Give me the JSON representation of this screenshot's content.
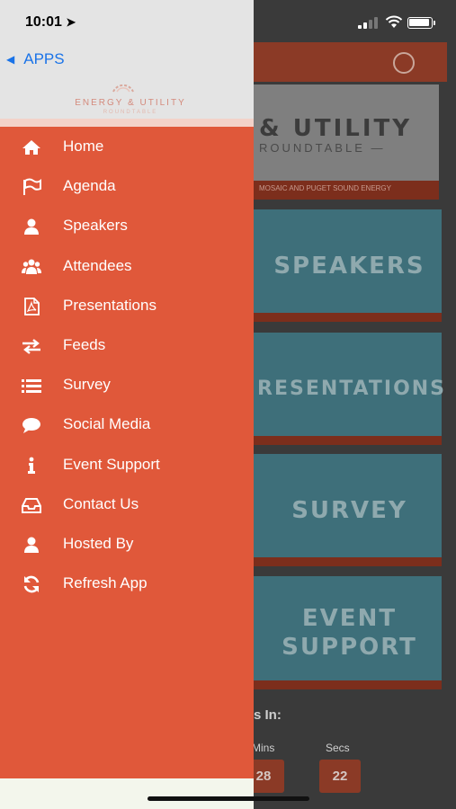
{
  "status_bar": {
    "time": "10:01"
  },
  "drawer": {
    "back_label": "APPS",
    "logo": {
      "line1": "ENERGY & UTILITY",
      "line2": "ROUNDTABLE"
    },
    "menu": [
      {
        "label": "Home",
        "icon": "home-icon"
      },
      {
        "label": "Agenda",
        "icon": "flag-icon"
      },
      {
        "label": "Speakers",
        "icon": "user-icon"
      },
      {
        "label": "Attendees",
        "icon": "users-icon"
      },
      {
        "label": "Presentations",
        "icon": "pdf-file-icon"
      },
      {
        "label": "Feeds",
        "icon": "exchange-icon"
      },
      {
        "label": "Survey",
        "icon": "list-icon"
      },
      {
        "label": "Social Media",
        "icon": "comment-icon"
      },
      {
        "label": "Event Support",
        "icon": "info-icon"
      },
      {
        "label": "Contact Us",
        "icon": "inbox-icon"
      },
      {
        "label": "Hosted By",
        "icon": "user-icon"
      },
      {
        "label": "Refresh App",
        "icon": "refresh-icon"
      }
    ]
  },
  "background_app": {
    "banner_title": "& UTILITY",
    "banner_subtitle": "ROUNDTABLE —",
    "banner_caption": "MOSAIC AND PUGET SOUND ENERGY",
    "tiles": [
      "SPEAKERS",
      "RESENTATIONS",
      "SURVEY",
      "EVENT",
      "SUPPORT"
    ],
    "countdown_label": "s In:",
    "mins_label": "Mins",
    "secs_label": "Secs",
    "mins_value": "28",
    "secs_value": "22"
  },
  "colors": {
    "drawer": "#e0583a",
    "link": "#1a73e8",
    "tile": "#3e6f7a"
  }
}
